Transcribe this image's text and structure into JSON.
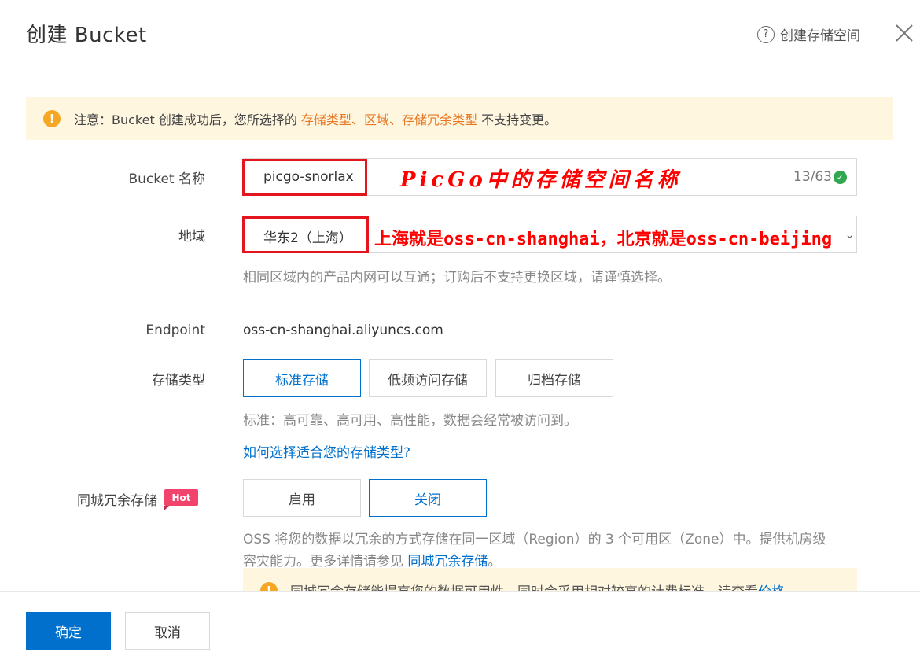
{
  "dialog": {
    "title": "创建 Bucket",
    "help_label": "创建存储空间"
  },
  "notice": {
    "prefix": "注意：Bucket 创建成功后，您所选择的 ",
    "storage_type": "存储类型",
    "sep1": "、",
    "region": "区域",
    "sep2": "、",
    "redundancy": "存储冗余类型",
    "suffix": " 不支持变更。"
  },
  "form": {
    "bucket_name_label": "Bucket 名称",
    "bucket_name_value": "picgo-snorlax",
    "bucket_name_counter": "13/63",
    "region_label": "地域",
    "region_value": "华东2（上海）",
    "region_hint": "相同区域内的产品内网可以互通；订购后不支持更换区域，请谨慎选择。",
    "endpoint_label": "Endpoint",
    "endpoint_value": "oss-cn-shanghai.aliyuncs.com",
    "storage_class_label": "存储类型",
    "storage_class_options": [
      "标准存储",
      "低频访问存储",
      "归档存储"
    ],
    "storage_class_selected": "标准存储",
    "storage_class_hint": "标准：高可靠、高可用、高性能，数据会经常被访问到。",
    "storage_class_link": "如何选择适合您的存储类型?",
    "redundancy_label": "同城冗余存储",
    "redundancy_badge": "Hot",
    "redundancy_options": [
      "启用",
      "关闭"
    ],
    "redundancy_selected": "关闭",
    "redundancy_desc_line1": "OSS 将您的数据以冗余的方式存储在同一区域（Region）的 3 个可用区（Zone）中。提供机房级",
    "redundancy_desc_line2": "容灾能力。更多详情请参见 ",
    "redundancy_desc_link": "同城冗余存储",
    "redundancy_desc_end": "。",
    "redundancy_notice": "同城冗余存储能提高您的数据可用性，同时会采用相对较高的计费标准，请查看 ",
    "redundancy_notice_link": "价格"
  },
  "annotations": {
    "bucket_note": "PicGo中的存储空间名称",
    "region_note": "上海就是oss-cn-shanghai，北京就是oss-cn-beijing"
  },
  "footer": {
    "confirm_label": "确定",
    "cancel_label": "取消"
  },
  "colors": {
    "primary": "#0070cc",
    "warning": "#f5a623",
    "notice_bg": "#fff6e0",
    "annotation_red": "#ff0000",
    "hot_badge": "#f2436d",
    "success": "#2fa84f"
  }
}
